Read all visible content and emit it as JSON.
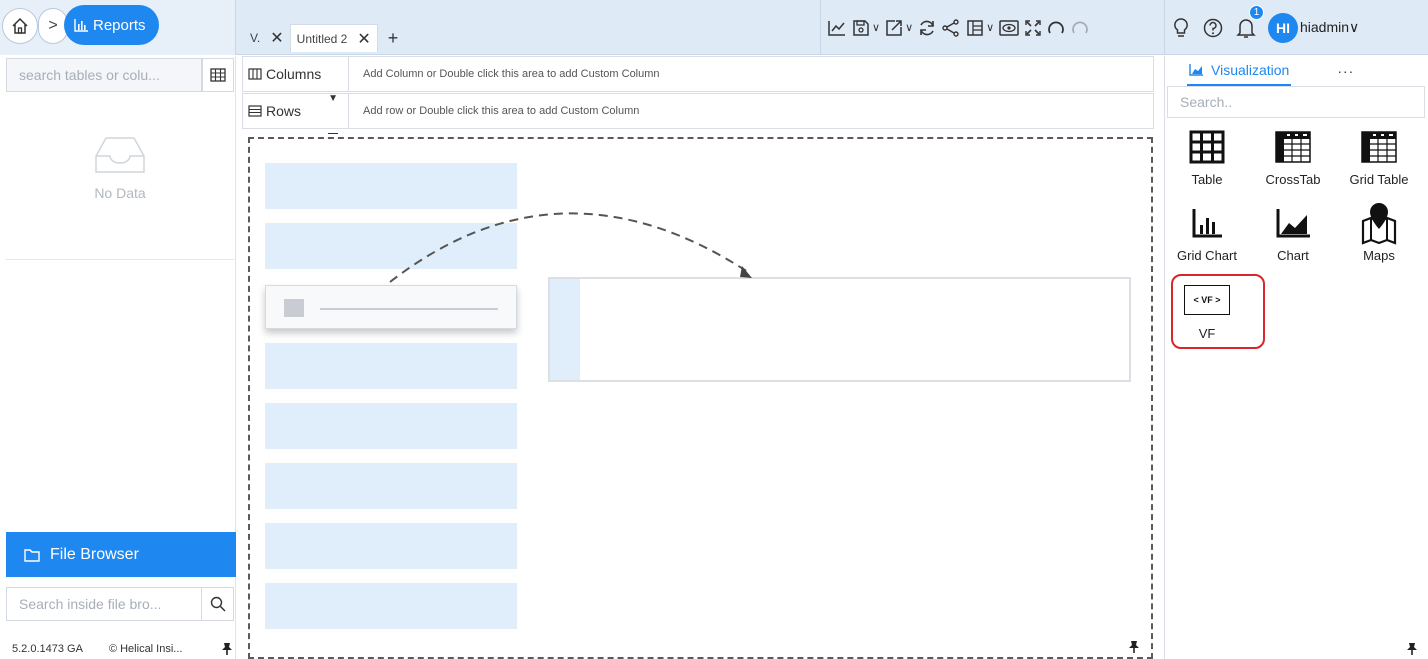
{
  "nav": {
    "reports_label": "Reports",
    "breadcrumb_arrow": ">"
  },
  "tabs": [
    {
      "label": "V.",
      "close": "✕"
    },
    {
      "label": "Untitled 2",
      "close": "✕"
    }
  ],
  "tab_add": "+",
  "user": {
    "initials": "HI",
    "name": "hiadmin",
    "caret": "∨",
    "notifications": "1"
  },
  "left": {
    "search_placeholder": "search tables or colu...",
    "no_data": "No Data",
    "file_browser": "File Browser",
    "file_search_placeholder": "Search inside file bro...",
    "version": "5.2.0.1473 GA",
    "copyright": "© Helical Insi..."
  },
  "shelves": {
    "columns_label": "Columns",
    "columns_hint": "Add Column or Double click this area to add Custom Column",
    "rows_label": "Rows",
    "rows_hint": "Add row or Double click this area to add Custom Column"
  },
  "right": {
    "tab_label": "Visualization",
    "more": "···",
    "search_placeholder": "Search..",
    "items": [
      {
        "label": "Table",
        "icon": "table-icon"
      },
      {
        "label": "CrossTab",
        "icon": "crosstab-icon"
      },
      {
        "label": "Grid Table",
        "icon": "grid-table-icon"
      },
      {
        "label": "Grid Chart",
        "icon": "grid-chart-icon"
      },
      {
        "label": "Chart",
        "icon": "area-chart-icon"
      },
      {
        "label": "Maps",
        "icon": "map-pin-icon"
      },
      {
        "label": "VF",
        "icon": "vf-icon",
        "icon_text": "< VF >"
      }
    ]
  },
  "colors": {
    "accent": "#1e87f0",
    "highlight": "#d9262d",
    "placeholder_fill": "#dfeefa"
  }
}
